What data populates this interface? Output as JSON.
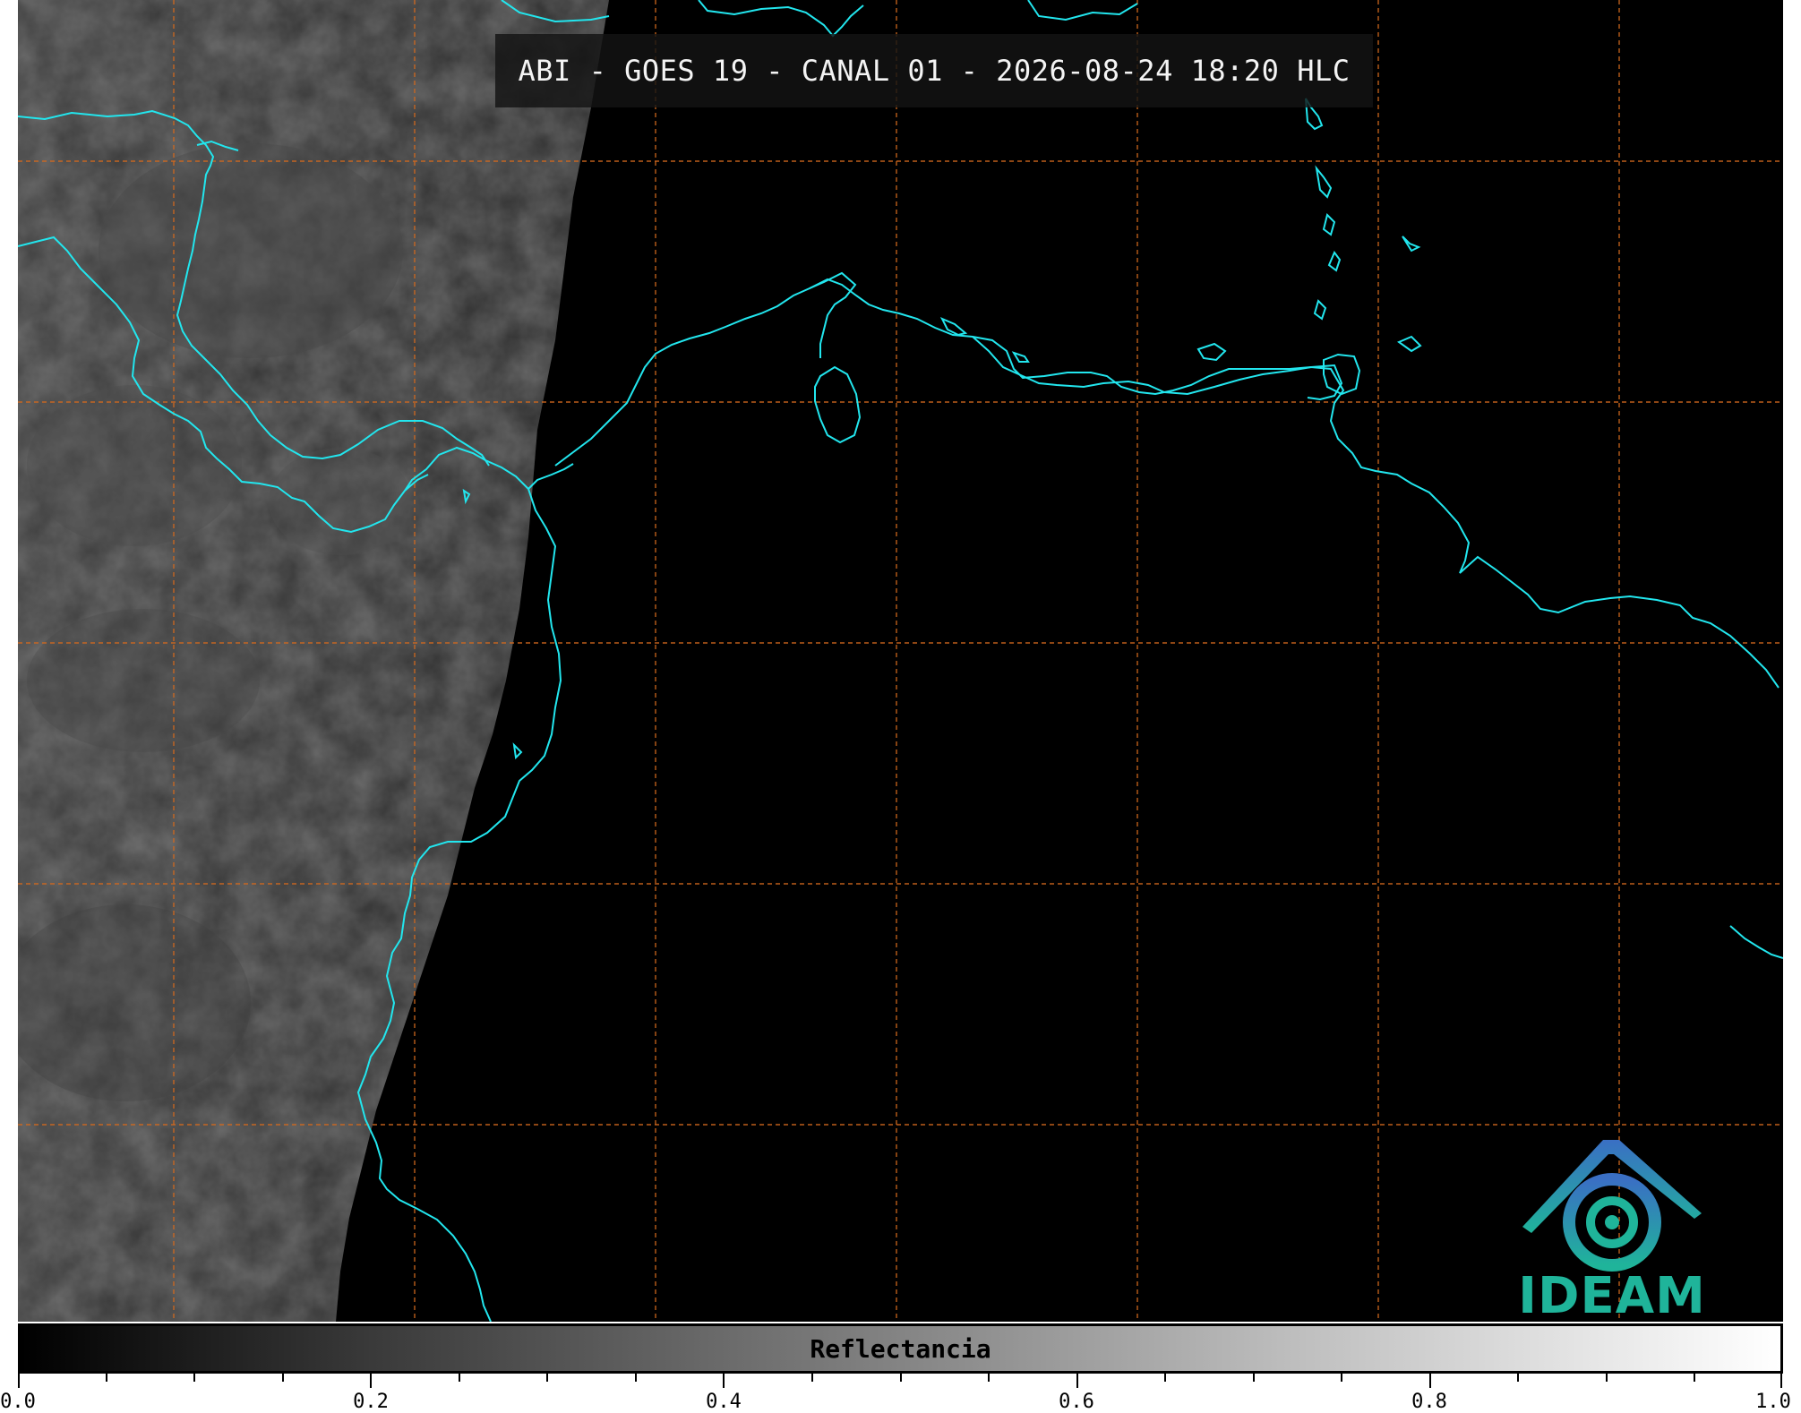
{
  "title": "ABI - GOES 19 - CANAL 01 - 2026-08-24 18:20 HLC",
  "colorbar": {
    "label": "Reflectancia",
    "tick_labels": [
      "0.0",
      "0.2",
      "0.4",
      "0.6",
      "0.8",
      "1.0"
    ]
  },
  "logo": {
    "text": "IDEAM"
  },
  "colors": {
    "coastline": "#22e6ee",
    "gridline": "#d2691e",
    "background": "#000000",
    "logo_blue": "#2f7fc0",
    "logo_green": "#1fb49a"
  }
}
